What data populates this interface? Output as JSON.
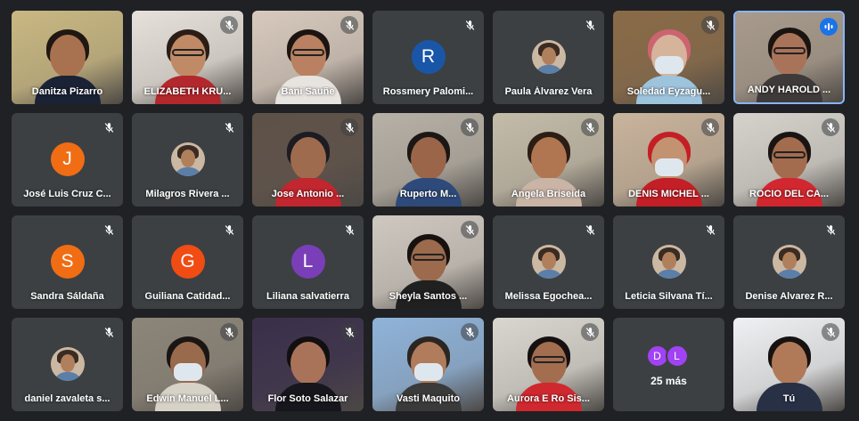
{
  "participants": [
    {
      "name": "Danitza Pizarro",
      "kind": "video",
      "muted": false,
      "scene": {
        "bg": "#c9b882",
        "skin": "#a8714f",
        "hair": "#1f1712",
        "shirt": "#1a2235"
      }
    },
    {
      "name": "ELIZABETH KRU...",
      "kind": "video",
      "muted": true,
      "scene": {
        "bg": "#e6e1da",
        "skin": "#c08a66",
        "hair": "#2a1d16",
        "shirt": "#b3282d",
        "glasses": true
      }
    },
    {
      "name": "Bani Sauñe",
      "kind": "video",
      "muted": true,
      "scene": {
        "bg": "#d7c9bd",
        "skin": "#b98161",
        "hair": "#1b1411",
        "shirt": "#e7e3df",
        "glasses": true
      }
    },
    {
      "name": "Rossmery Palomi...",
      "kind": "letter",
      "letter": "R",
      "color": "#1a56a8",
      "muted": true
    },
    {
      "name": "Paula Álvarez Vera",
      "kind": "photo",
      "muted": true
    },
    {
      "name": "Soledad Eyzagu...",
      "kind": "video",
      "muted": true,
      "scene": {
        "bg": "#8a6b47",
        "skin": "#d5b49b",
        "hair": "#cc6470",
        "shirt": "#9ec3dd",
        "mask": true
      }
    },
    {
      "name": "ANDY HAROLD ...",
      "kind": "video",
      "muted": false,
      "speaking": true,
      "scene": {
        "bg": "#a89b8c",
        "skin": "#a9735a",
        "hair": "#1a1411",
        "shirt": "#3e3a39",
        "glasses": true
      }
    },
    {
      "name": "José Luis Cruz C...",
      "kind": "letter",
      "letter": "J",
      "color": "#f06d14",
      "muted": true
    },
    {
      "name": "Milagros Rivera ...",
      "kind": "photo",
      "muted": true
    },
    {
      "name": "Jose Antonio ...",
      "kind": "video",
      "muted": true,
      "scene": {
        "bg": "#5e5148",
        "skin": "#9f6b4f",
        "hair": "#1c1c22",
        "shirt": "#c2262e"
      }
    },
    {
      "name": "Ruperto M...",
      "kind": "video",
      "muted": true,
      "scene": {
        "bg": "#b6b0a6",
        "skin": "#9b6549",
        "hair": "#1b1714",
        "shirt": "#2e4a7a"
      }
    },
    {
      "name": "Angela Briseida",
      "kind": "video",
      "muted": true,
      "scene": {
        "bg": "#c4bca9",
        "skin": "#b07652",
        "hair": "#2c1d15",
        "shirt": "#c9b4a6"
      }
    },
    {
      "name": "DENIS MICHEL ...",
      "kind": "video",
      "muted": true,
      "scene": {
        "bg": "#c9b49c",
        "skin": "#c29271",
        "hair": "#c41e26",
        "shirt": "#c41e26",
        "mask": true
      }
    },
    {
      "name": "ROCIO DEL CA...",
      "kind": "video",
      "muted": true,
      "scene": {
        "bg": "#d6d2cc",
        "skin": "#a36c4e",
        "hair": "#1a1412",
        "shirt": "#d2272f",
        "glasses": true
      }
    },
    {
      "name": "Sandra Sáldaña",
      "kind": "letter",
      "letter": "S",
      "color": "#f06d14",
      "muted": true
    },
    {
      "name": "Guiliana Catidad...",
      "kind": "letter",
      "letter": "G",
      "color": "#f04c14",
      "muted": true
    },
    {
      "name": "Liliana salvatierra",
      "kind": "letter",
      "letter": "L",
      "color": "#7a3fb8",
      "muted": true
    },
    {
      "name": "Sheyla Santos ...",
      "kind": "video",
      "muted": true,
      "scene": {
        "bg": "#cfc8c0",
        "skin": "#9c6a4d",
        "hair": "#171210",
        "shirt": "#202020",
        "glasses": true
      }
    },
    {
      "name": "Melissa Egochea...",
      "kind": "photo",
      "muted": true
    },
    {
      "name": "Leticia Silvana Tí...",
      "kind": "photo",
      "muted": true
    },
    {
      "name": "Denise Alvarez R...",
      "kind": "photo",
      "muted": true
    },
    {
      "name": "daniel zavaleta s...",
      "kind": "photo",
      "muted": true
    },
    {
      "name": "Edwin Manuel L...",
      "kind": "video",
      "muted": true,
      "scene": {
        "bg": "#8c8579",
        "skin": "#9a6a4c",
        "hair": "#1a1614",
        "shirt": "#d6d2c6",
        "mask": true
      }
    },
    {
      "name": "Flor Soto Salazar",
      "kind": "video",
      "muted": true,
      "scene": {
        "bg": "#3a2f4a",
        "skin": "#a9735a",
        "hair": "#120f10",
        "shirt": "#16161c"
      }
    },
    {
      "name": "Vasti Maquito",
      "kind": "video",
      "muted": true,
      "scene": {
        "bg": "#8fb3d9",
        "skin": "#b07c5c",
        "hair": "#2b2622",
        "shirt": "#3a3a3a",
        "mask": true
      }
    },
    {
      "name": "Aurora E Ro Sis...",
      "kind": "video",
      "muted": true,
      "scene": {
        "bg": "#d9d6cf",
        "skin": "#a36d50",
        "hair": "#161110",
        "shirt": "#d0282f",
        "glasses": true
      }
    },
    {
      "name": "25 más",
      "kind": "more",
      "letters": [
        "D",
        "L"
      ],
      "muted": false
    },
    {
      "name": "Tú",
      "kind": "video",
      "muted": true,
      "scene": {
        "bg": "#eef0f3",
        "skin": "#b07a59",
        "hair": "#171211",
        "shirt": "#283046"
      }
    }
  ]
}
